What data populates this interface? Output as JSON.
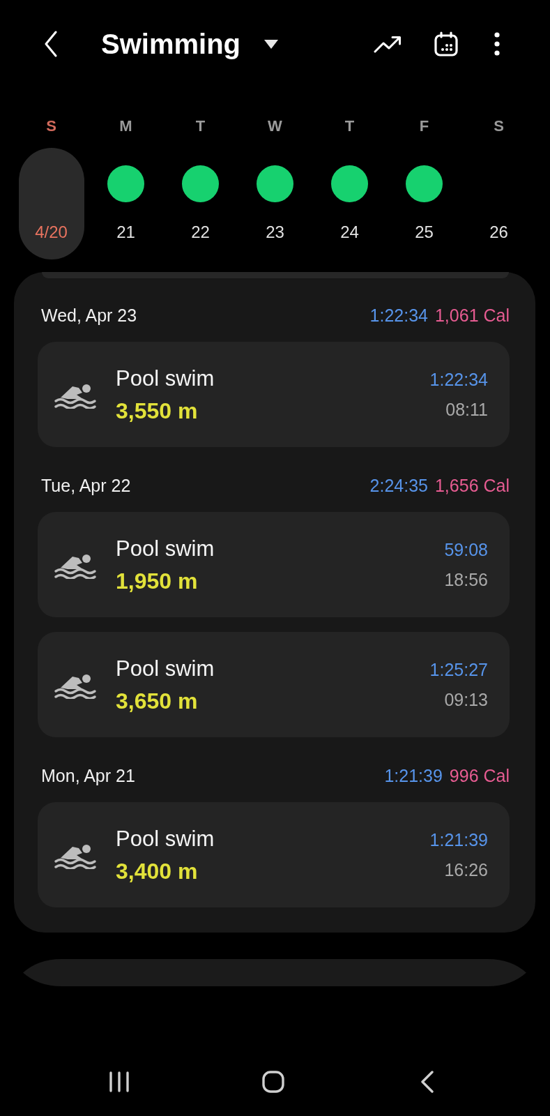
{
  "header": {
    "title": "Swimming"
  },
  "week": [
    {
      "letter": "S",
      "date": "4/20",
      "selected": true,
      "workout": false
    },
    {
      "letter": "M",
      "date": "21",
      "selected": false,
      "workout": true
    },
    {
      "letter": "T",
      "date": "22",
      "selected": false,
      "workout": true
    },
    {
      "letter": "W",
      "date": "23",
      "selected": false,
      "workout": true
    },
    {
      "letter": "T",
      "date": "24",
      "selected": false,
      "workout": true
    },
    {
      "letter": "F",
      "date": "25",
      "selected": false,
      "workout": true
    },
    {
      "letter": "S",
      "date": "26",
      "selected": false,
      "workout": false
    }
  ],
  "groups": [
    {
      "date": "Wed, Apr 23",
      "total_time": "1:22:34",
      "calories": "1,061 Cal",
      "sessions": [
        {
          "name": "Pool swim",
          "distance": "3,550 m",
          "duration": "1:22:34",
          "time": "08:11"
        }
      ]
    },
    {
      "date": "Tue, Apr 22",
      "total_time": "2:24:35",
      "calories": "1,656 Cal",
      "sessions": [
        {
          "name": "Pool swim",
          "distance": "1,950 m",
          "duration": "59:08",
          "time": "18:56"
        },
        {
          "name": "Pool swim",
          "distance": "3,650 m",
          "duration": "1:25:27",
          "time": "09:13"
        }
      ]
    },
    {
      "date": "Mon, Apr 21",
      "total_time": "1:21:39",
      "calories": "996 Cal",
      "sessions": [
        {
          "name": "Pool swim",
          "distance": "3,400 m",
          "duration": "1:21:39",
          "time": "16:26"
        }
      ]
    }
  ]
}
